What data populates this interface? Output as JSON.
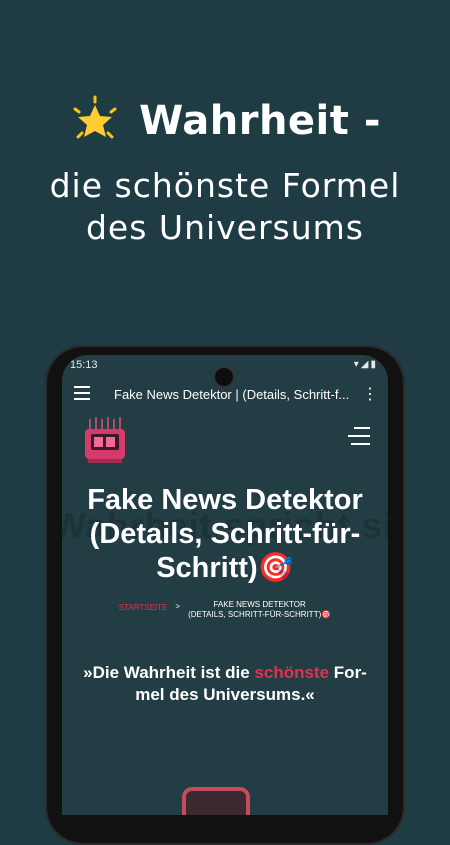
{
  "headline": {
    "line1": "Wahrheit -",
    "line2": "die schönste Formel",
    "line3": "des Universums"
  },
  "status": {
    "time": "15:13",
    "icons": "▾◢▮"
  },
  "appbar": {
    "title": "Fake News Detektor | (Details, Schritt-f...",
    "more_icon": "⋮"
  },
  "page": {
    "ghost_text": "Wahrheit spricht sich",
    "title_line1": "Fake News Detektor",
    "title_line2": "(Details, Schritt-für-",
    "title_line3": "Schritt)",
    "title_emoji": "🎯"
  },
  "breadcrumb": {
    "home": "STARTSEITE",
    "separator": ">",
    "current_line1": "FAKE NEWS DETEKTOR",
    "current_line2": "(DETAILS, SCHRITT-FÜR-SCHRITT)🎯"
  },
  "quote": {
    "part1": "»Die Wahrheit ist die ",
    "highlight": "schönste",
    "part2": " For-",
    "line2": "mel des Universums.«"
  },
  "colors": {
    "background": "#1f3b44",
    "screen": "#233d44",
    "accent": "#e0324f"
  }
}
